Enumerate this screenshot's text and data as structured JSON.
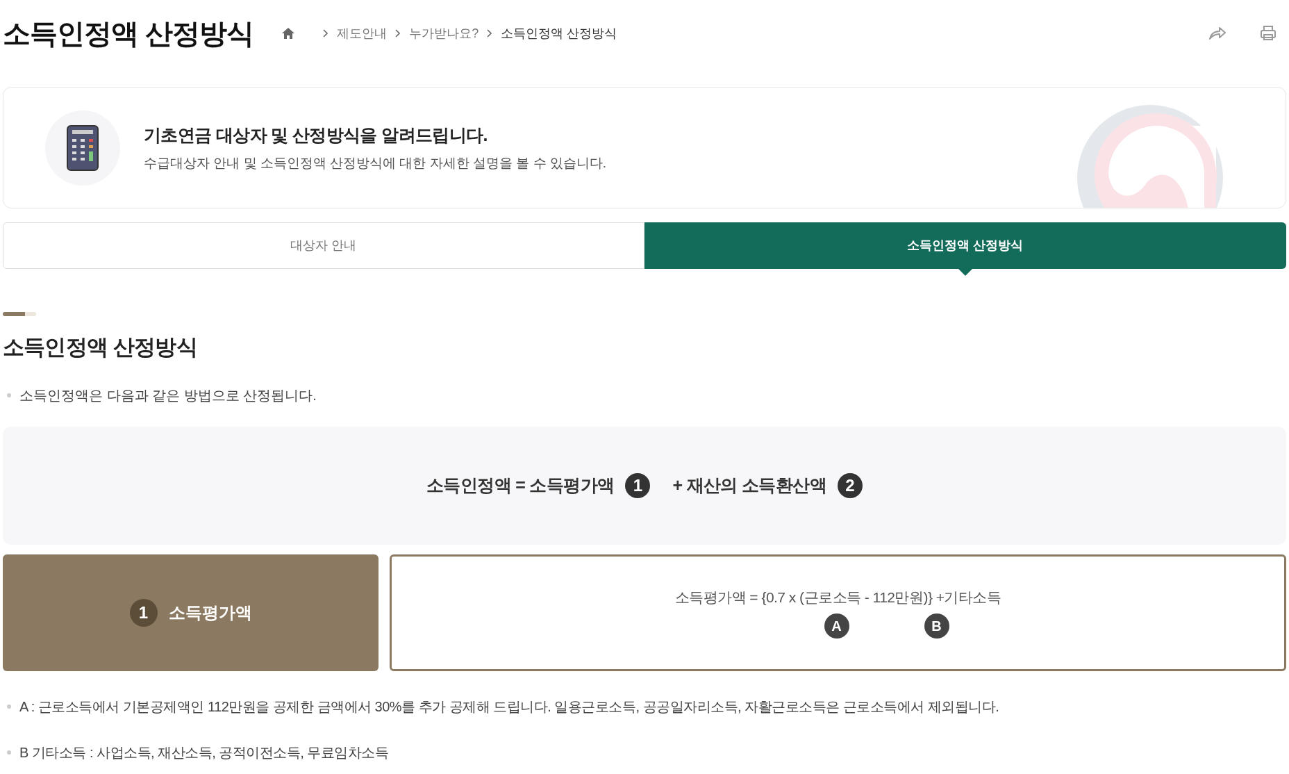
{
  "page_title": "소득인정액 산정방식",
  "breadcrumb": [
    "제도안내",
    "누가받나요?",
    "소득인정액 산정방식"
  ],
  "banner": {
    "title": "기초연금 대상자 및 산정방식을 알려드립니다.",
    "description": "수급대상자 안내 및 소득인정액 산정방식에 대한 자세한 설명을 볼 수 있습니다."
  },
  "tabs": [
    {
      "label": "대상자 안내",
      "selected": false
    },
    {
      "label": "소득인정액 산정방식",
      "selected": true
    }
  ],
  "section_title": "소득인정액 산정방식",
  "intro": "소득인정액은 다음과 같은 방법으로 산정됩니다.",
  "formula": {
    "parts": [
      {
        "text": "소득인정액 = 소득평가액",
        "badge": "1"
      },
      {
        "text": "+ 재산의 소득환산액",
        "badge": "2"
      }
    ]
  },
  "card": {
    "badge": "1",
    "title": "소득평가액",
    "formula": "소득평가액 = {0.7 x (근로소득 - 112만원)} +기타소득",
    "markers": [
      "A",
      "B"
    ]
  },
  "notes": [
    "A : 근로소득에서 기본공제액인 112만원을 공제한 금액에서 30%를 추가 공제해 드립니다. 일용근로소득, 공공일자리소득, 자활근로소득은 근로소득에서 제외됩니다.",
    "B 기타소득 : 사업소득, 재산소득, 공적이전소득, 무료임차소득"
  ]
}
